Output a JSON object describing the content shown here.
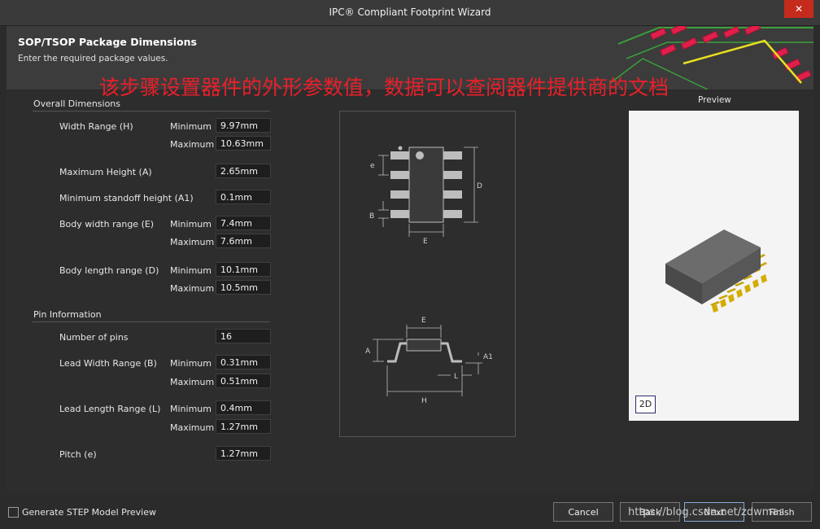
{
  "window": {
    "title": "IPC® Compliant Footprint Wizard",
    "close_glyph": "✕"
  },
  "header": {
    "title": "SOP/TSOP Package Dimensions",
    "subtitle": "Enter the required package values."
  },
  "annotation": "该步骤设置器件的外形参数值，数据可以查阅器件提供商的文档",
  "overall": {
    "section_title": "Overall Dimensions",
    "width_label": "Width Range (H)",
    "width_min": "9.97mm",
    "width_max": "10.63mm",
    "height_label": "Maximum Height (A)",
    "height_value": "2.65mm",
    "standoff_label": "Minimum standoff height (A1)",
    "standoff_value": "0.1mm",
    "body_width_label": "Body width range (E)",
    "body_width_min": "7.4mm",
    "body_width_max": "7.6mm",
    "body_length_label": "Body length range (D)",
    "body_length_min": "10.1mm",
    "body_length_max": "10.5mm"
  },
  "pins": {
    "section_title": "Pin Information",
    "count_label": "Number of pins",
    "count_value": "16",
    "lead_width_label": "Lead Width Range (B)",
    "lead_width_min": "0.31mm",
    "lead_width_max": "0.51mm",
    "lead_length_label": "Lead Length Range (L)",
    "lead_length_min": "0.4mm",
    "lead_length_max": "1.27mm",
    "pitch_label": "Pitch (e)",
    "pitch_value": "1.27mm"
  },
  "labels": {
    "minimum": "Minimum",
    "maximum": "Maximum"
  },
  "diagram": {
    "e": "e",
    "b": "B",
    "d": "D",
    "e_body": "E",
    "a": "A",
    "a1": "A1",
    "l": "L",
    "h": "H"
  },
  "preview": {
    "label": "Preview",
    "mode_button": "2D"
  },
  "footer": {
    "step_checkbox_label": "Generate STEP Model Preview",
    "cancel": "Cancel",
    "back": "Back",
    "next": "Next",
    "finish": "Finish",
    "watermark": "https://blog.csdn.net/zdwmas"
  }
}
